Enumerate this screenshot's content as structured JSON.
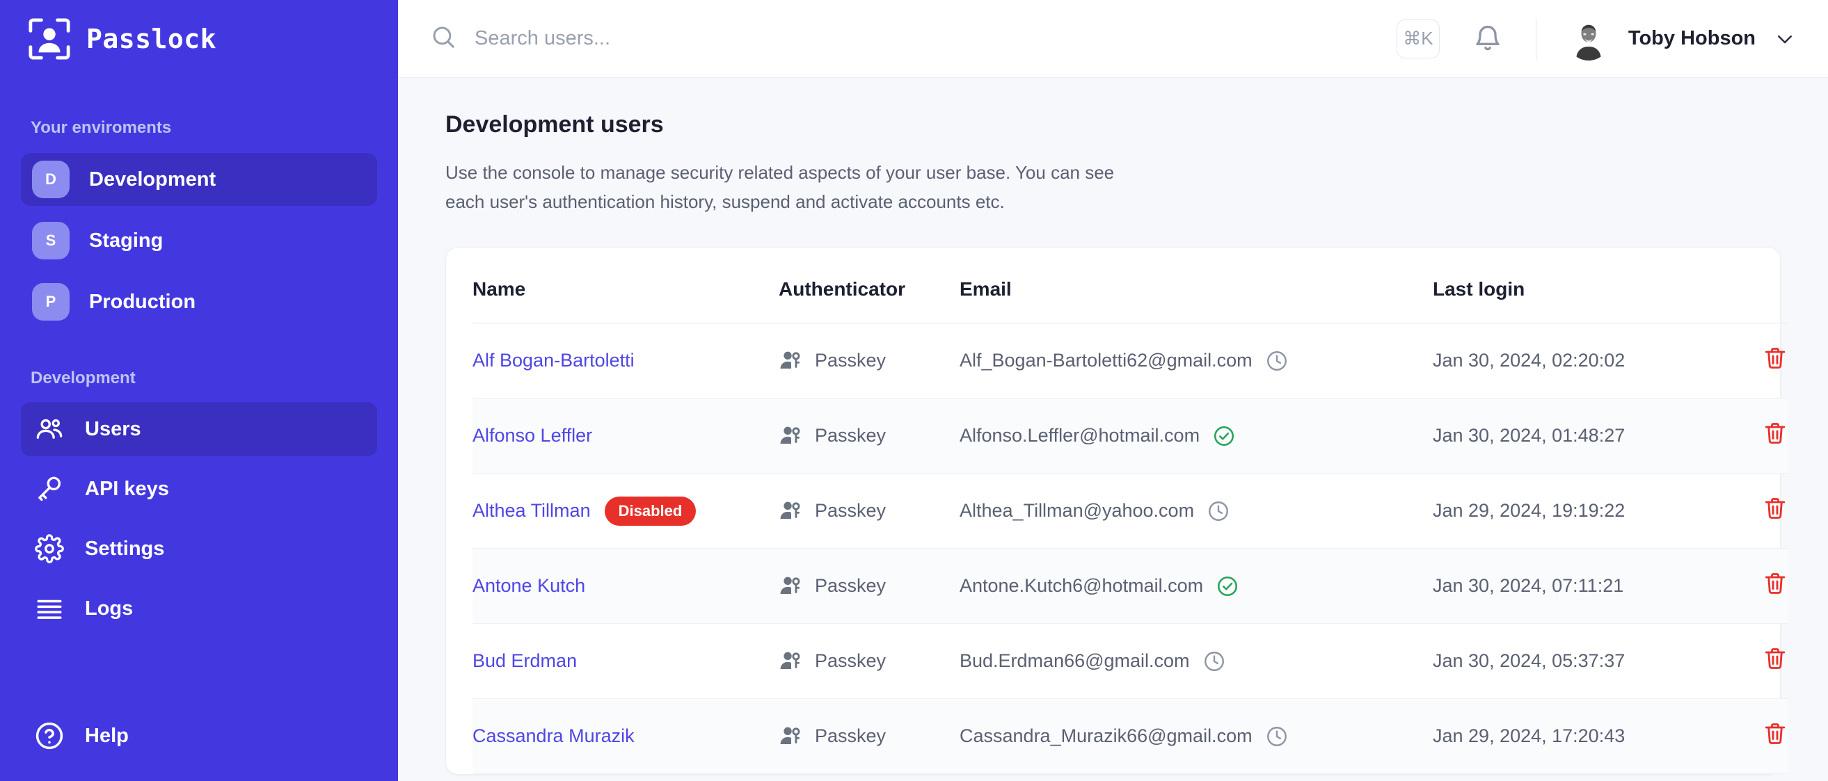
{
  "brand": {
    "name": "Passlock",
    "logo_icon": "user-scan-icon"
  },
  "sidebar": {
    "environments_label": "Your enviroments",
    "environments": [
      {
        "initial": "D",
        "label": "Development",
        "active": true
      },
      {
        "initial": "S",
        "label": "Staging",
        "active": false
      },
      {
        "initial": "P",
        "label": "Production",
        "active": false
      }
    ],
    "current_env_label": "Development",
    "nav": [
      {
        "label": "Users",
        "icon": "users-icon",
        "active": true
      },
      {
        "label": "API keys",
        "icon": "key-icon",
        "active": false
      },
      {
        "label": "Settings",
        "icon": "gear-icon",
        "active": false
      },
      {
        "label": "Logs",
        "icon": "list-icon",
        "active": false
      }
    ],
    "help": {
      "label": "Help",
      "icon": "question-circle-icon"
    }
  },
  "topbar": {
    "search": {
      "placeholder": "Search users...",
      "value": "",
      "icon": "search-icon"
    },
    "shortcut_badge": "⌘K",
    "notifications_icon": "bell-icon",
    "user": {
      "name": "Toby Hobson",
      "avatar": "user-avatar",
      "caret_icon": "chevron-down-icon"
    }
  },
  "page": {
    "title": "Development users",
    "description": "Use the console to manage security related aspects of your user base. You can see each user's authentication history, suspend and activate accounts etc."
  },
  "table": {
    "columns": [
      "Name",
      "Authenticator",
      "Email",
      "Last login",
      ""
    ],
    "rows": [
      {
        "name": "Alf Bogan-Bartoletti",
        "badge": "",
        "authenticator": "Passkey",
        "auth_icon": "passkey-user-icon",
        "email": "Alf_Bogan-Bartoletti62@gmail.com",
        "email_status": "pending",
        "email_status_icon": "clock-icon",
        "last_login": "Jan 30, 2024, 02:20:02",
        "delete_icon": "trash-icon"
      },
      {
        "name": "Alfonso Leffler",
        "badge": "",
        "authenticator": "Passkey",
        "auth_icon": "passkey-user-icon",
        "email": "Alfonso.Leffler@hotmail.com",
        "email_status": "verified",
        "email_status_icon": "check-circle-icon",
        "last_login": "Jan 30, 2024, 01:48:27",
        "delete_icon": "trash-icon"
      },
      {
        "name": "Althea Tillman",
        "badge": "Disabled",
        "authenticator": "Passkey",
        "auth_icon": "passkey-user-icon",
        "email": "Althea_Tillman@yahoo.com",
        "email_status": "pending",
        "email_status_icon": "clock-icon",
        "last_login": "Jan 29, 2024, 19:19:22",
        "delete_icon": "trash-icon"
      },
      {
        "name": "Antone Kutch",
        "badge": "",
        "authenticator": "Passkey",
        "auth_icon": "passkey-user-icon",
        "email": "Antone.Kutch6@hotmail.com",
        "email_status": "verified",
        "email_status_icon": "check-circle-icon",
        "last_login": "Jan 30, 2024, 07:11:21",
        "delete_icon": "trash-icon"
      },
      {
        "name": "Bud Erdman",
        "badge": "",
        "authenticator": "Passkey",
        "auth_icon": "passkey-user-icon",
        "email": "Bud.Erdman66@gmail.com",
        "email_status": "pending",
        "email_status_icon": "clock-icon",
        "last_login": "Jan 30, 2024, 05:37:37",
        "delete_icon": "trash-icon"
      },
      {
        "name": "Cassandra Murazik",
        "badge": "",
        "authenticator": "Passkey",
        "auth_icon": "passkey-user-icon",
        "email": "Cassandra_Murazik66@gmail.com",
        "email_status": "pending",
        "email_status_icon": "clock-icon",
        "last_login": "Jan 29, 2024, 17:20:43",
        "delete_icon": "trash-icon"
      }
    ]
  },
  "colors": {
    "sidebar_bg": "#4338e0",
    "sidebar_active": "#3a2fc0",
    "link": "#4f46e5",
    "danger": "#e8302a",
    "verified": "#22a559",
    "content_bg": "#f7f8fc"
  }
}
